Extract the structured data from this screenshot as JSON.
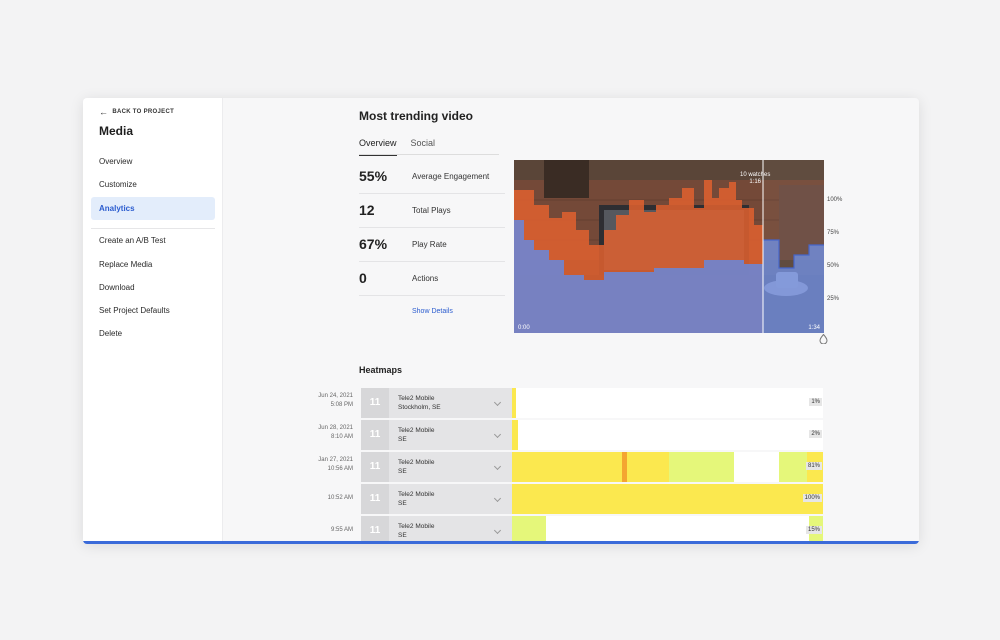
{
  "sidebar": {
    "back_label": "BACK TO PROJECT",
    "title": "Media",
    "items": [
      {
        "label": "Overview"
      },
      {
        "label": "Customize"
      },
      {
        "label": "Analytics",
        "active": true
      },
      {
        "label": "Create an A/B Test"
      },
      {
        "label": "Replace Media"
      },
      {
        "label": "Download"
      },
      {
        "label": "Set Project Defaults"
      },
      {
        "label": "Delete"
      }
    ]
  },
  "trending": {
    "title": "Most trending video",
    "tabs": [
      {
        "label": "Overview",
        "active": true
      },
      {
        "label": "Social"
      }
    ],
    "stats": [
      {
        "value": "55%",
        "label": "Average Engagement"
      },
      {
        "value": "12",
        "label": "Total Plays"
      },
      {
        "value": "67%",
        "label": "Play Rate"
      },
      {
        "value": "0",
        "label": "Actions"
      }
    ],
    "show_details": "Show Details",
    "video": {
      "tooltip_watches": "10 watches",
      "tooltip_time": "1:16",
      "start_time": "0:00",
      "end_time": "1:34",
      "y_ticks": [
        "100%",
        "75%",
        "50%",
        "25%"
      ],
      "colors": {
        "rewatch": "#e0602f",
        "engagement": "#6b86d6"
      }
    }
  },
  "heatmaps": {
    "title": "Heatmaps",
    "rows": [
      {
        "date": "Jun 24, 2021",
        "time": "5:08 PM",
        "count": "11",
        "name": "Tele2 Mobile",
        "location": "Stockholm, SE",
        "percent": "1%",
        "segments": [
          {
            "start": 0,
            "end": 0.012,
            "color": "#fbe84f"
          }
        ]
      },
      {
        "date": "Jun 28, 2021",
        "time": "8:10 AM",
        "count": "11",
        "name": "Tele2 Mobile",
        "location": "SE",
        "percent": "2%",
        "segments": [
          {
            "start": 0,
            "end": 0.02,
            "color": "#fbe84f"
          }
        ]
      },
      {
        "date": "Jan 27, 2021",
        "time": "10:56 AM",
        "count": "11",
        "name": "Tele2 Mobile",
        "location": "SE",
        "percent": "81%",
        "segments": [
          {
            "start": 0,
            "end": 0.355,
            "color": "#fbe84f"
          },
          {
            "start": 0.355,
            "end": 0.37,
            "color": "#f4a531"
          },
          {
            "start": 0.37,
            "end": 0.505,
            "color": "#fbe84f"
          },
          {
            "start": 0.505,
            "end": 0.715,
            "color": "#e5f77a"
          },
          {
            "start": 0.86,
            "end": 0.95,
            "color": "#e5f77a"
          },
          {
            "start": 0.95,
            "end": 1.0,
            "color": "#fbe84f"
          }
        ]
      },
      {
        "date": "",
        "time": "10:52 AM",
        "count": "11",
        "name": "Tele2 Mobile",
        "location": "SE",
        "percent": "100%",
        "segments": [
          {
            "start": 0,
            "end": 1.0,
            "color": "#fbe84f"
          }
        ]
      },
      {
        "date": "",
        "time": "9:55 AM",
        "count": "11",
        "name": "Tele2 Mobile",
        "location": "SE",
        "percent": "15%",
        "segments": [
          {
            "start": 0,
            "end": 0.11,
            "color": "#e5f77a"
          },
          {
            "start": 0.955,
            "end": 1.0,
            "color": "#e5f77a"
          }
        ]
      }
    ]
  }
}
